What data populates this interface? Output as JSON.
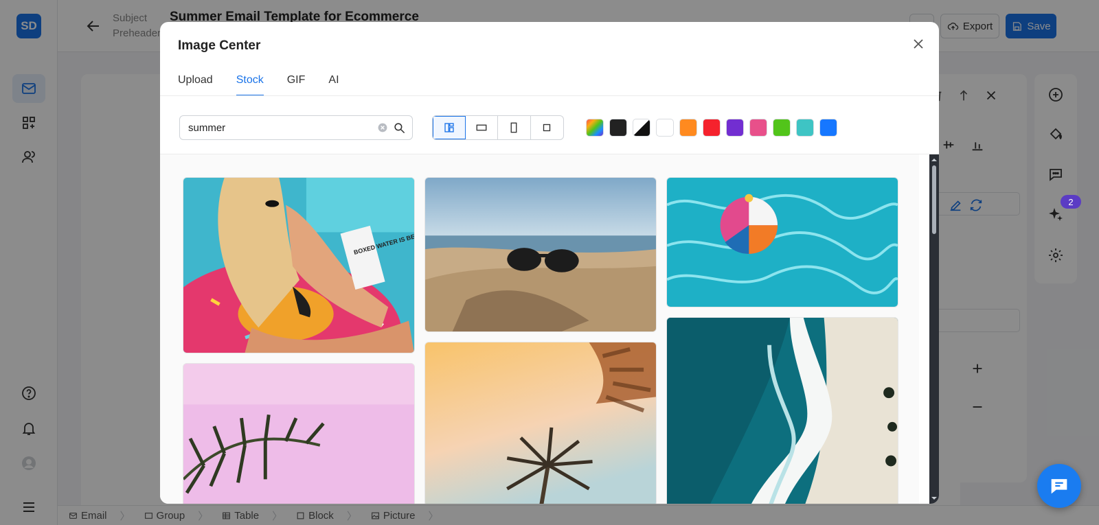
{
  "app": {
    "logo": "SD",
    "subject_label": "Subject",
    "preheader_label": "Preheader",
    "doc_title": "Summer Email Template for Ecommerce",
    "more_label": "···",
    "export_label": "Export",
    "save_label": "Save",
    "badge_count": "2"
  },
  "breadcrumb": [
    "Email",
    "Group",
    "Table",
    "Block",
    "Picture"
  ],
  "modal": {
    "title": "Image Center",
    "tabs": [
      "Upload",
      "Stock",
      "GIF",
      "AI"
    ],
    "active_tab": "Stock",
    "search_value": "summer",
    "orientation_options": [
      "all-orientations-icon",
      "landscape-icon",
      "portrait-icon",
      "square-icon"
    ],
    "colors": [
      "#multicolor",
      "#222222",
      "#black-white",
      "#ffffff",
      "#ff8a1f",
      "#f5222d",
      "#722ed1",
      "#e8508a",
      "#52c41a",
      "#3ec4c4",
      "#1677ff"
    ],
    "images": [
      {
        "subject": "woman on donut float with drink carton"
      },
      {
        "subject": "sunglasses on beach sand"
      },
      {
        "subject": "beach ball in pool water"
      },
      {
        "subject": "palm leaves on pink sky"
      },
      {
        "subject": "palm tree on orange sky"
      },
      {
        "subject": "aerial ocean waves on beach"
      }
    ],
    "drink_text": "BOXED WATER IS BETTER"
  }
}
